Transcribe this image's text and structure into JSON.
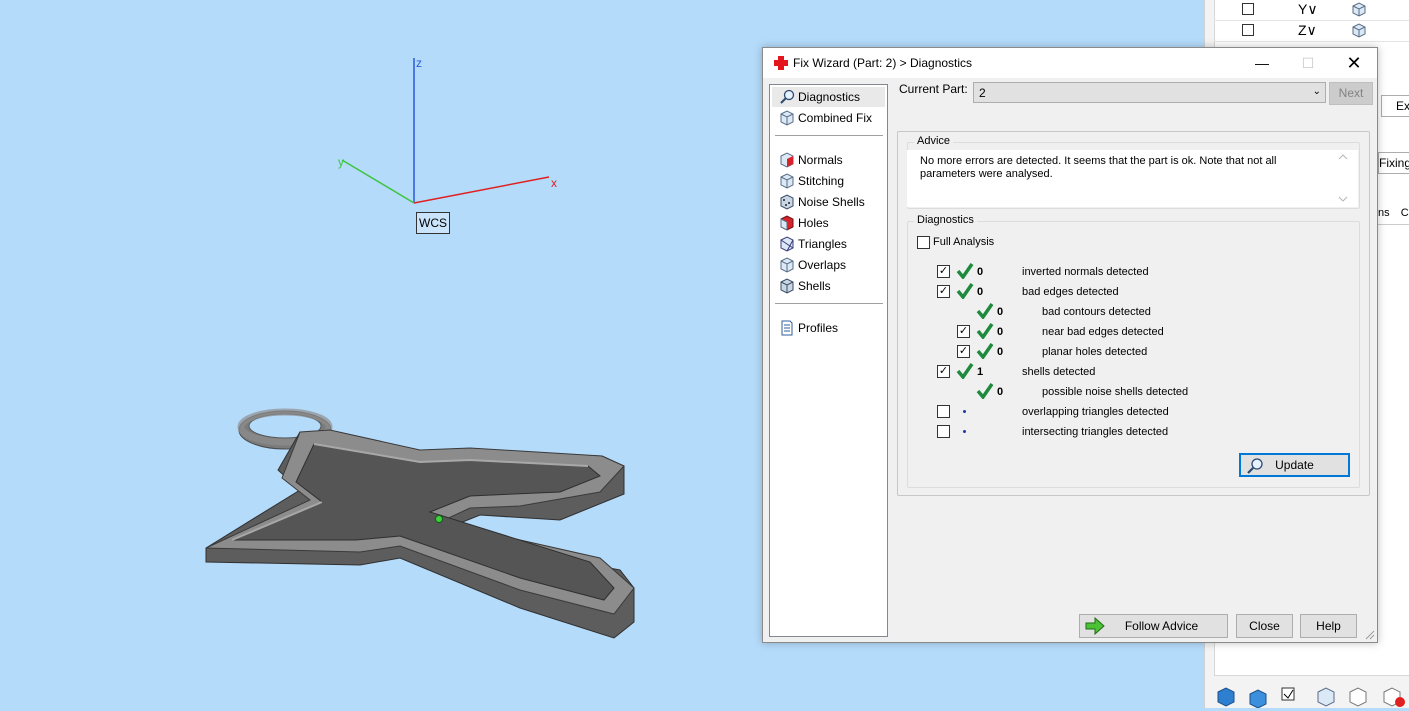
{
  "viewport": {
    "axes": {
      "x_label": "x",
      "y_label": "y",
      "z_label": "z"
    },
    "wcs_label": "WCS",
    "model": "cross-shaped pendant part"
  },
  "right_panel": {
    "rows": [
      {
        "axis": "Y∨"
      },
      {
        "axis": "Z∨"
      }
    ],
    "exp_button": "Exp",
    "fixing_tab": "Fixing",
    "header_cols": [
      "ns",
      "Co"
    ]
  },
  "dialog": {
    "title": "Fix Wizard (Part: 2) > Diagnostics",
    "nav": {
      "diagnostics": "Diagnostics",
      "combined_fix": "Combined Fix",
      "normals": "Normals",
      "stitching": "Stitching",
      "noise_shells": "Noise Shells",
      "holes": "Holes",
      "triangles": "Triangles",
      "overlaps": "Overlaps",
      "shells": "Shells",
      "profiles": "Profiles"
    },
    "current_part_label": "Current Part:",
    "current_part_value": "2",
    "next_button": "Next",
    "advice_title": "Advice",
    "advice_text": "No more errors are detected. It seems that the part is ok. Note that not all parameters were analysed.",
    "diagnostics_title": "Diagnostics",
    "full_analysis_label": "Full Analysis",
    "rows": [
      {
        "count": "0",
        "label": "inverted normals detected"
      },
      {
        "count": "0",
        "label": "bad edges detected"
      },
      {
        "count": "0",
        "label": "bad contours detected"
      },
      {
        "count": "0",
        "label": "near bad edges detected"
      },
      {
        "count": "0",
        "label": "planar holes detected"
      },
      {
        "count": "1",
        "label": "shells detected"
      },
      {
        "count": "0",
        "label": "possible noise shells detected"
      },
      {
        "count": "",
        "label": "overlapping triangles detected"
      },
      {
        "count": "",
        "label": "intersecting triangles detected"
      }
    ],
    "update_button": "Update",
    "follow_advice_button": "Follow Advice",
    "close_button": "Close",
    "help_button": "Help",
    "colors": {
      "accent": "#0078d7",
      "ok_green": "#1e8a3c",
      "axis_x": "#e02020",
      "axis_y": "#3ec43e",
      "axis_z": "#2a5bd7"
    }
  }
}
